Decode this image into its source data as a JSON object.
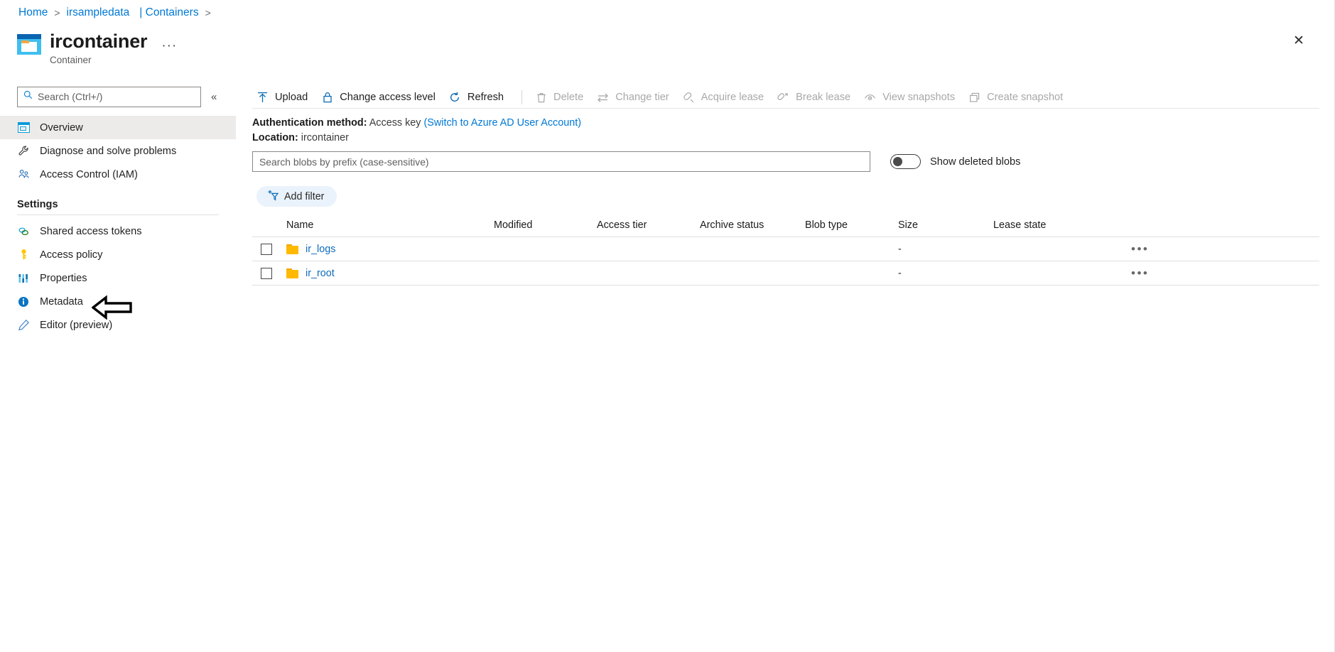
{
  "breadcrumb": {
    "items": [
      {
        "label": "Home",
        "sep": ">"
      },
      {
        "label": "irsampledata",
        "sep": ""
      },
      {
        "label": "| Containers",
        "sep": ">"
      }
    ]
  },
  "header": {
    "title": "ircontainer",
    "subtitle": "Container",
    "icon": "container-icon",
    "ellipsis": "···",
    "close": "✕"
  },
  "sidebar": {
    "search": {
      "placeholder": "Search (Ctrl+/)",
      "icon": "search-icon"
    },
    "collapse": "«",
    "items": [
      {
        "label": "Overview",
        "icon": "overview-icon",
        "selected": true
      },
      {
        "label": "Diagnose and solve problems",
        "icon": "wrench-icon",
        "selected": false
      },
      {
        "label": "Access Control (IAM)",
        "icon": "people-icon",
        "selected": false
      }
    ],
    "section_title": "Settings",
    "settings_items": [
      {
        "label": "Shared access tokens",
        "icon": "link-icon"
      },
      {
        "label": "Access policy",
        "icon": "key-icon"
      },
      {
        "label": "Properties",
        "icon": "sliders-icon"
      },
      {
        "label": "Metadata",
        "icon": "info-icon"
      },
      {
        "label": "Editor (preview)",
        "icon": "pencil-icon"
      }
    ]
  },
  "toolbar": {
    "buttons": [
      {
        "label": "Upload",
        "icon": "upload-arrow-icon",
        "disabled": false
      },
      {
        "label": "Change access level",
        "icon": "lock-icon",
        "disabled": false
      },
      {
        "label": "Refresh",
        "icon": "refresh-icon",
        "disabled": false
      },
      {
        "label": "Delete",
        "icon": "trash-icon",
        "disabled": true
      },
      {
        "label": "Change tier",
        "icon": "swap-arrows-icon",
        "disabled": true
      },
      {
        "label": "Acquire lease",
        "icon": "plug-icon",
        "disabled": true
      },
      {
        "label": "Break lease",
        "icon": "plug-break-icon",
        "disabled": true
      },
      {
        "label": "View snapshots",
        "icon": "snapshot-view-icon",
        "disabled": true
      },
      {
        "label": "Create snapshot",
        "icon": "snapshot-create-icon",
        "disabled": true
      }
    ]
  },
  "auth": {
    "method_label": "Authentication method:",
    "method_value": "Access key",
    "switch_link": "(Switch to Azure AD User Account)",
    "location_label": "Location:",
    "location_value": "ircontainer"
  },
  "filters": {
    "blob_search_placeholder": "Search blobs by prefix (case-sensitive)",
    "blob_search_value": "",
    "toggle_label": "Show deleted blobs",
    "toggle_on": false,
    "add_filter_label": "Add filter",
    "add_filter_icon": "add-filter-icon"
  },
  "table": {
    "columns": [
      "Name",
      "Modified",
      "Access tier",
      "Archive status",
      "Blob type",
      "Size",
      "Lease state"
    ],
    "rows": [
      {
        "checked": false,
        "icon": "folder-icon",
        "name": "ir_logs",
        "modified": "",
        "access_tier": "",
        "archive_status": "",
        "blob_type": "",
        "size": "-",
        "lease_state": "",
        "menu": "•••"
      },
      {
        "checked": false,
        "icon": "folder-icon",
        "name": "ir_root",
        "modified": "",
        "access_tier": "",
        "archive_status": "",
        "blob_type": "",
        "size": "-",
        "lease_state": "",
        "menu": "•••"
      }
    ]
  },
  "annotation": {
    "arrow": "left-arrow-annotation",
    "points_to": "Properties"
  },
  "colors": {
    "accent": "#0078d4",
    "link": "#0f6cbd",
    "folder": "#ffb900",
    "selected_bg": "#edebe9",
    "disabled_text": "#a8a8a8"
  }
}
